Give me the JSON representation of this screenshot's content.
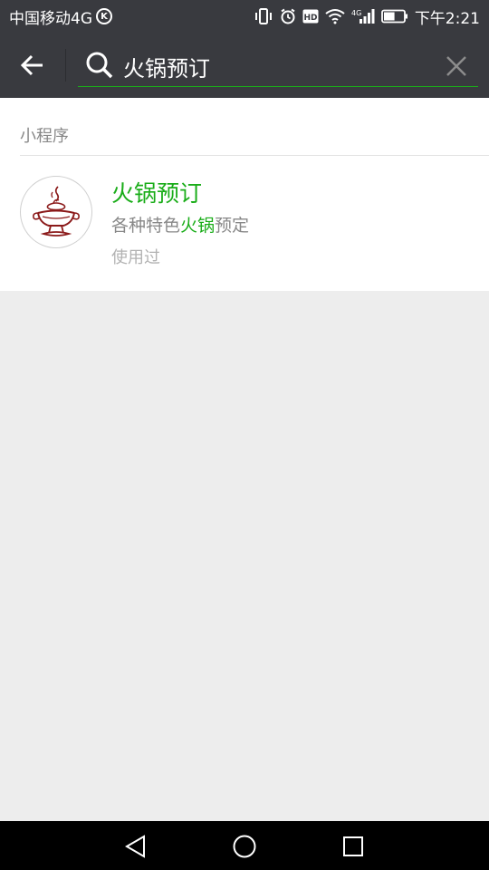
{
  "status_bar": {
    "carrier": "中国移动4G",
    "carrier_badge": "K",
    "hd_label": "HD",
    "network_label": "4G",
    "time": "下午2:21",
    "battery_level": 0.55,
    "icons": [
      "vibrate-icon",
      "alarm-icon",
      "hd-icon",
      "wifi-icon",
      "signal-icon",
      "battery-icon"
    ]
  },
  "search": {
    "query": "火锅预订",
    "accent_color": "#1aad19",
    "header_bg": "#393a3f"
  },
  "results": {
    "section_label": "小程序",
    "items": [
      {
        "title": "火锅预订",
        "description_before": "各种特色",
        "description_highlight": "火锅",
        "description_after": "预定",
        "meta": "使用过",
        "avatar_icon": "hotpot-icon"
      }
    ]
  },
  "nav_bar": {
    "icons": [
      "back-triangle-icon",
      "home-circle-icon",
      "recents-square-icon"
    ]
  }
}
